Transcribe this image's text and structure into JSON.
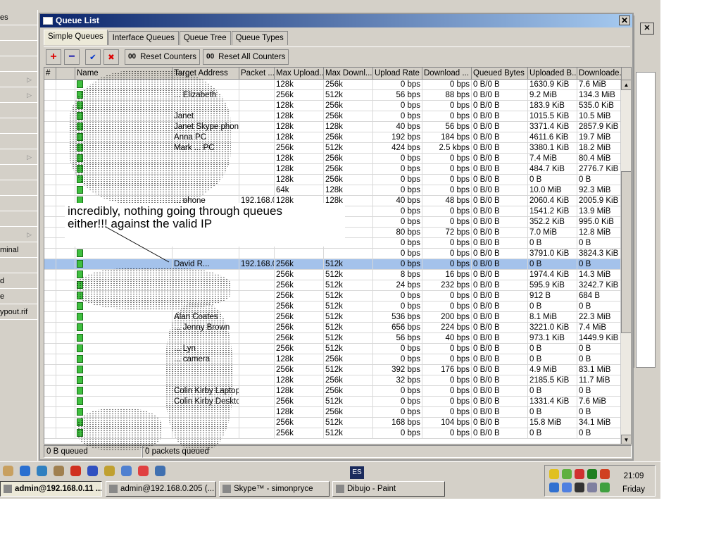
{
  "left_panel": {
    "items": [
      "es",
      "",
      "",
      "",
      "",
      "",
      "",
      "",
      "",
      "",
      "",
      "",
      "",
      "",
      "",
      "minal",
      "",
      "d",
      "e",
      "ypout.rif"
    ]
  },
  "window": {
    "title": "Queue List",
    "close": "✕"
  },
  "tabs": [
    "Simple Queues",
    "Interface Queues",
    "Queue Tree",
    "Queue Types"
  ],
  "toolbar": {
    "add": "+",
    "remove": "−",
    "enable": "✔",
    "disable": "✖",
    "reset_counters": "Reset Counters",
    "reset_all_counters": "Reset All Counters",
    "counter_icon": "00"
  },
  "columns": [
    "#",
    "",
    "Name",
    "Target Address",
    "Packet ...",
    "Max Upload...",
    "Max Downl...",
    "Upload Rate",
    "Download ...",
    "Queued Bytes",
    "Uploaded B...",
    "Downloade..."
  ],
  "rows": [
    [
      "",
      "",
      "",
      "128k",
      "256k",
      "0 bps",
      "0 bps",
      "0 B/0 B",
      "1630.9 KiB",
      "7.6 MiB"
    ],
    [
      "",
      "... Elizabeth",
      "",
      "256k",
      "512k",
      "56 bps",
      "88 bps",
      "0 B/0 B",
      "9.2 MiB",
      "134.3 MiB"
    ],
    [
      "",
      "",
      "",
      "128k",
      "256k",
      "0 bps",
      "0 bps",
      "0 B/0 B",
      "183.9 KiB",
      "535.0 KiB"
    ],
    [
      "",
      "Janet",
      "",
      "128k",
      "256k",
      "0 bps",
      "0 bps",
      "0 B/0 B",
      "1015.5 KiB",
      "10.5 MiB"
    ],
    [
      "",
      "Janet Skype phone",
      "",
      "128k",
      "128k",
      "40 bps",
      "56 bps",
      "0 B/0 B",
      "3371.4 KiB",
      "2857.9 KiB"
    ],
    [
      "",
      "Anna PC",
      "",
      "128k",
      "256k",
      "192 bps",
      "184 bps",
      "0 B/0 B",
      "4611.6 KiB",
      "19.7 MiB"
    ],
    [
      "",
      "Mark ... PC",
      "",
      "256k",
      "512k",
      "424 bps",
      "2.5 kbps",
      "0 B/0 B",
      "3380.1 KiB",
      "18.2 MiB"
    ],
    [
      "",
      "",
      "",
      "128k",
      "256k",
      "0 bps",
      "0 bps",
      "0 B/0 B",
      "7.4 MiB",
      "80.4 MiB"
    ],
    [
      "",
      "",
      "",
      "128k",
      "256k",
      "0 bps",
      "0 bps",
      "0 B/0 B",
      "484.7 KiB",
      "2776.7 KiB"
    ],
    [
      "",
      "",
      "",
      "128k",
      "256k",
      "0 bps",
      "0 bps",
      "0 B/0 B",
      "0 B",
      "0 B"
    ],
    [
      "",
      "",
      "",
      "64k",
      "128k",
      "0 bps",
      "0 bps",
      "0 B/0 B",
      "10.0 MiB",
      "92.3 MiB"
    ],
    [
      "",
      "... phone",
      "192.168.0.164",
      "128k",
      "128k",
      "40 bps",
      "48 bps",
      "0 B/0 B",
      "2060.4 KiB",
      "2005.9 KiB"
    ],
    [
      "",
      "",
      "",
      "",
      "",
      "0 bps",
      "0 bps",
      "0 B/0 B",
      "1541.2 KiB",
      "13.9 MiB"
    ],
    [
      "",
      "",
      "",
      "",
      "",
      "0 bps",
      "0 bps",
      "0 B/0 B",
      "352.2 KiB",
      "995.0 KiB"
    ],
    [
      "",
      "",
      "",
      "",
      "",
      "80 bps",
      "72 bps",
      "0 B/0 B",
      "7.0 MiB",
      "12.8 MiB"
    ],
    [
      "",
      "",
      "",
      "",
      "",
      "0 bps",
      "0 bps",
      "0 B/0 B",
      "0 B",
      "0 B"
    ],
    [
      "",
      "",
      "",
      "",
      "",
      "0 bps",
      "0 bps",
      "0 B/0 B",
      "3791.0 KiB",
      "3824.3 KiB"
    ],
    [
      "",
      "David R...",
      "192.168.0.170",
      "256k",
      "512k",
      "0 bps",
      "0 bps",
      "0 B/0 B",
      "0 B",
      "0 B"
    ],
    [
      "",
      "",
      "",
      "256k",
      "512k",
      "8 bps",
      "16 bps",
      "0 B/0 B",
      "1974.4 KiB",
      "14.3 MiB"
    ],
    [
      "",
      "",
      "",
      "256k",
      "512k",
      "24 bps",
      "232 bps",
      "0 B/0 B",
      "595.9 KiB",
      "3242.7 KiB"
    ],
    [
      "",
      "",
      "",
      "256k",
      "512k",
      "0 bps",
      "0 bps",
      "0 B/0 B",
      "912 B",
      "684 B"
    ],
    [
      "",
      "",
      "",
      "256k",
      "512k",
      "0 bps",
      "0 bps",
      "0 B/0 B",
      "0 B",
      "0 B"
    ],
    [
      "",
      "Alan Coates",
      "",
      "256k",
      "512k",
      "536 bps",
      "200 bps",
      "0 B/0 B",
      "8.1 MiB",
      "22.3 MiB"
    ],
    [
      "",
      "... Jenny Brown",
      "",
      "256k",
      "512k",
      "656 bps",
      "224 bps",
      "0 B/0 B",
      "3221.0 KiB",
      "7.4 MiB"
    ],
    [
      "",
      "",
      "",
      "256k",
      "512k",
      "56 bps",
      "40 bps",
      "0 B/0 B",
      "973.1 KiB",
      "1449.9 KiB"
    ],
    [
      "",
      "... Lyn",
      "",
      "256k",
      "512k",
      "0 bps",
      "0 bps",
      "0 B/0 B",
      "0 B",
      "0 B"
    ],
    [
      "",
      "... camera",
      "",
      "128k",
      "256k",
      "0 bps",
      "0 bps",
      "0 B/0 B",
      "0 B",
      "0 B"
    ],
    [
      "",
      "",
      "",
      "256k",
      "512k",
      "392 bps",
      "176 bps",
      "0 B/0 B",
      "4.9 MiB",
      "83.1 MiB"
    ],
    [
      "",
      "",
      "",
      "128k",
      "256k",
      "32 bps",
      "0 bps",
      "0 B/0 B",
      "2185.5 KiB",
      "11.7 MiB"
    ],
    [
      "",
      "Colin Kirby Laptop",
      "",
      "128k",
      "256k",
      "0 bps",
      "0 bps",
      "0 B/0 B",
      "0 B",
      "0 B"
    ],
    [
      "",
      "Colin Kirby Desktop",
      "",
      "256k",
      "512k",
      "0 bps",
      "0 bps",
      "0 B/0 B",
      "1331.4 KiB",
      "7.6 MiB"
    ],
    [
      "",
      "",
      "",
      "128k",
      "256k",
      "0 bps",
      "0 bps",
      "0 B/0 B",
      "0 B",
      "0 B"
    ],
    [
      "",
      "",
      "",
      "256k",
      "512k",
      "168 bps",
      "104 bps",
      "0 B/0 B",
      "15.8 MiB",
      "34.1 MiB"
    ],
    [
      "",
      "",
      "",
      "256k",
      "512k",
      "0 bps",
      "0 bps",
      "0 B/0 B",
      "0 B",
      "0 B"
    ]
  ],
  "selected_row": 17,
  "status": {
    "queued_bytes": "0 B queued",
    "queued_packets": "0 packets queued"
  },
  "annotation": {
    "text_line1": "incredibly, nothing going through queues",
    "text_line2": "either!!! against the valid IP"
  },
  "taskbar": {
    "tasks": [
      "admin@192.168.0.11 ...",
      "admin@192.168.0.205 (...",
      "Skype™ - simonpryce",
      "Dibujo - Paint"
    ],
    "language": "ES",
    "clock": "21:09",
    "day": "Friday"
  },
  "colors": {
    "title_start": "#0a246a",
    "selected_row": "#a4c2eb",
    "queue_icon": "#3fbf3f"
  }
}
